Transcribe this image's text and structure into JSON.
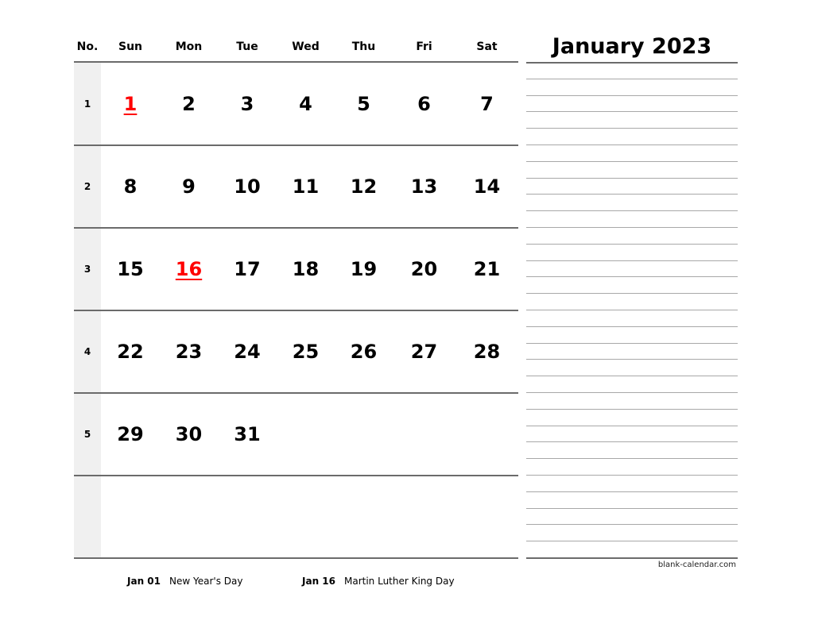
{
  "calendar": {
    "month_title": "January 2023",
    "headers": [
      "No.",
      "Sun",
      "Mon",
      "Tue",
      "Wed",
      "Thu",
      "Fri",
      "Sat"
    ],
    "weeks": [
      {
        "number": "1",
        "days": [
          "1",
          "2",
          "3",
          "4",
          "5",
          "6",
          "7"
        ]
      },
      {
        "number": "2",
        "days": [
          "8",
          "9",
          "10",
          "11",
          "12",
          "13",
          "14"
        ]
      },
      {
        "number": "3",
        "days": [
          "15",
          "16",
          "17",
          "18",
          "19",
          "20",
          "21"
        ]
      },
      {
        "number": "4",
        "days": [
          "22",
          "23",
          "24",
          "25",
          "26",
          "27",
          "28"
        ]
      },
      {
        "number": "5",
        "days": [
          "29",
          "30",
          "31",
          "",
          "",
          "",
          ""
        ]
      },
      {
        "number": "",
        "days": [
          "",
          "",
          "",
          "",
          "",
          "",
          ""
        ]
      }
    ],
    "holiday_days": [
      "1",
      "16"
    ],
    "holiday_color": "#ff0000"
  },
  "holidays": [
    {
      "date": "Jan 01",
      "name": "New Year's Day"
    },
    {
      "date": "Jan 16",
      "name": "Martin Luther King Day"
    }
  ],
  "footer": {
    "credit": "blank-calendar.com"
  }
}
